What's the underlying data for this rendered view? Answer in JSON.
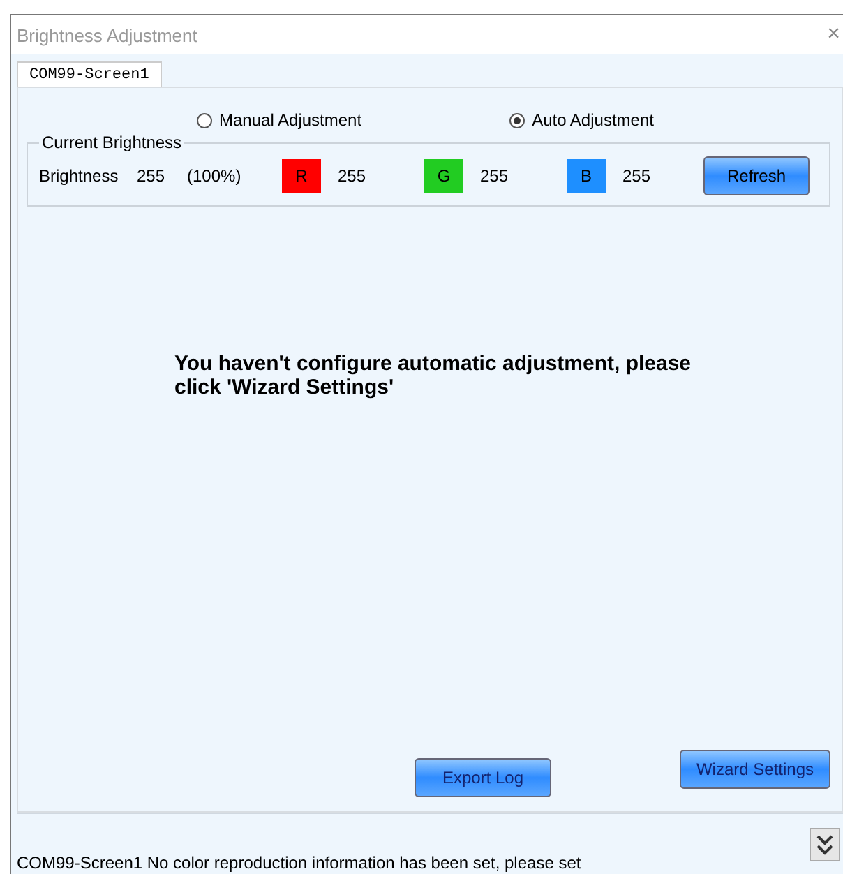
{
  "window": {
    "title": "Brightness Adjustment",
    "close": "×"
  },
  "tabs": [
    {
      "label": "COM99-Screen1",
      "selected": true
    }
  ],
  "modes": [
    {
      "label": "Manual Adjustment",
      "selected": false
    },
    {
      "label": "Auto Adjustment",
      "selected": true
    }
  ],
  "current_brightness": {
    "title": "Current Brightness",
    "label": "Brightness",
    "value": "255",
    "percent": "(100%)",
    "channels": [
      {
        "label": "R",
        "color": "#ff0000",
        "value": "255"
      },
      {
        "label": "G",
        "color": "#22cc22",
        "value": "255"
      },
      {
        "label": "B",
        "color": "#1e8fff",
        "value": "255"
      }
    ],
    "refresh": "Refresh"
  },
  "message": "You haven't configure automatic adjustment, please click 'Wizard Settings'",
  "buttons": {
    "export": "Export Log",
    "wizard": "Wizard Settings"
  },
  "status_bar": {
    "text": "COM99-Screen1 No color reproduction information has been set, please set"
  }
}
